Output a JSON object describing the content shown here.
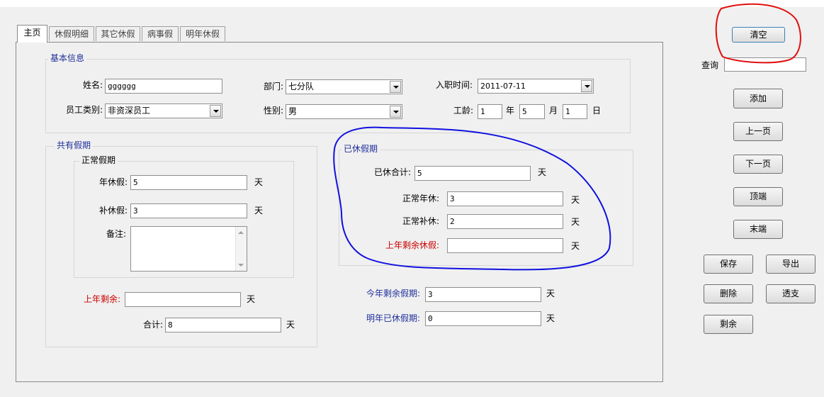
{
  "tabs": [
    "主页",
    "休假明细",
    "其它休假",
    "病事假",
    "明年休假"
  ],
  "basic_info": {
    "legend": "基本信息",
    "name_label": "姓名:",
    "name_value": "gggggg",
    "dept_label": "部门:",
    "dept_value": "七分队",
    "hire_label": "入职时间:",
    "hire_value": "2011-07-11",
    "emp_type_label": "员工类别:",
    "emp_type_value": "非资深员工",
    "gender_label": "性别:",
    "gender_value": "男",
    "seniority_label": "工龄:",
    "years_value": "1",
    "years_unit": "年",
    "months_value": "5",
    "months_unit": "月",
    "days_value": "1",
    "days_unit": "日"
  },
  "shared": {
    "legend": "共有假期",
    "normal_legend": "正常假期",
    "annual_label": "年休假:",
    "annual_value": "5",
    "comp_label": "补休假:",
    "comp_value": "3",
    "note_label": "备注:",
    "last_year_label": "上年剩余:",
    "last_year_value": "",
    "total_label": "合计:",
    "total_value": "8",
    "unit": "天"
  },
  "taken": {
    "legend": "已休假期",
    "total_label": "已休合计:",
    "total_value": "5",
    "normal_annual_label": "正常年休:",
    "normal_annual_value": "3",
    "normal_comp_label": "正常补休:",
    "normal_comp_value": "2",
    "last_year_label": "上年剩余休假:",
    "last_year_value": "",
    "unit": "天"
  },
  "remaining": {
    "this_year_label": "今年剩余假期:",
    "this_year_value": "3",
    "next_year_label": "明年已休假期:",
    "next_year_value": "0",
    "unit": "天"
  },
  "side": {
    "clear": "清空",
    "query_label": "查询",
    "query_value": "",
    "add": "添加",
    "prev": "上一页",
    "next": "下一页",
    "first": "顶端",
    "last": "末端",
    "save": "保存",
    "export": "导出",
    "delete": "删除",
    "overdraw": "透支",
    "remaining": "剩余"
  },
  "colors": {
    "legend_blue": "#1f2f9a",
    "warn_red": "#cc0000",
    "annotation_red": "#e01010",
    "annotation_blue": "#1010e0"
  }
}
